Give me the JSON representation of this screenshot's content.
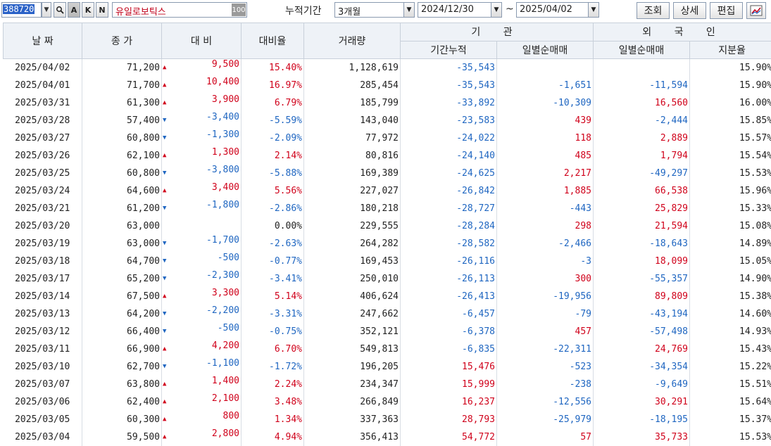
{
  "toolbar": {
    "stock_code": "388720",
    "stock_name": "유일로보틱스",
    "name_extra": "100",
    "period_label": "누적기간",
    "period_value": "3개월",
    "start_date": "2024/12/30",
    "tilde": "~",
    "end_date": "2025/04/02",
    "query_button": "조회",
    "detail_button": "상세",
    "edit_button": "편집",
    "small_btn_a": "A",
    "small_btn_k": "K",
    "small_btn_n": "N"
  },
  "headers": {
    "date": "날 짜",
    "close": "종 가",
    "change": "대 비",
    "change_rate": "대비율",
    "volume": "거래량",
    "institution": "기 관",
    "inst_cumulative": "기간누적",
    "inst_daily": "일별순매매",
    "foreign": "외 국 인",
    "foreign_daily": "일별순매매",
    "foreign_share": "지분율"
  },
  "rows": [
    {
      "date": "2025/04/02",
      "close": "71,200",
      "dir": "up",
      "change": "9,500",
      "rate": "15.40%",
      "volume": "1,128,619",
      "inst_cum": "-35,543",
      "inst_daily": "",
      "frgn_daily": "",
      "share": "15.90%"
    },
    {
      "date": "2025/04/01",
      "close": "71,700",
      "dir": "up",
      "change": "10,400",
      "rate": "16.97%",
      "volume": "285,454",
      "inst_cum": "-35,543",
      "inst_daily": "-1,651",
      "frgn_daily": "-11,594",
      "share": "15.90%"
    },
    {
      "date": "2025/03/31",
      "close": "61,300",
      "dir": "up",
      "change": "3,900",
      "rate": "6.79%",
      "volume": "185,799",
      "inst_cum": "-33,892",
      "inst_daily": "-10,309",
      "frgn_daily": "16,560",
      "share": "16.00%"
    },
    {
      "date": "2025/03/28",
      "close": "57,400",
      "dir": "down",
      "change": "-3,400",
      "rate": "-5.59%",
      "volume": "143,040",
      "inst_cum": "-23,583",
      "inst_daily": "439",
      "frgn_daily": "-2,444",
      "share": "15.85%"
    },
    {
      "date": "2025/03/27",
      "close": "60,800",
      "dir": "down",
      "change": "-1,300",
      "rate": "-2.09%",
      "volume": "77,972",
      "inst_cum": "-24,022",
      "inst_daily": "118",
      "frgn_daily": "2,889",
      "share": "15.57%"
    },
    {
      "date": "2025/03/26",
      "close": "62,100",
      "dir": "up",
      "change": "1,300",
      "rate": "2.14%",
      "volume": "80,816",
      "inst_cum": "-24,140",
      "inst_daily": "485",
      "frgn_daily": "1,794",
      "share": "15.54%"
    },
    {
      "date": "2025/03/25",
      "close": "60,800",
      "dir": "down",
      "change": "-3,800",
      "rate": "-5.88%",
      "volume": "169,389",
      "inst_cum": "-24,625",
      "inst_daily": "2,217",
      "frgn_daily": "-49,297",
      "share": "15.53%"
    },
    {
      "date": "2025/03/24",
      "close": "64,600",
      "dir": "up",
      "change": "3,400",
      "rate": "5.56%",
      "volume": "227,027",
      "inst_cum": "-26,842",
      "inst_daily": "1,885",
      "frgn_daily": "66,538",
      "share": "15.96%"
    },
    {
      "date": "2025/03/21",
      "close": "61,200",
      "dir": "down",
      "change": "-1,800",
      "rate": "-2.86%",
      "volume": "180,218",
      "inst_cum": "-28,727",
      "inst_daily": "-443",
      "frgn_daily": "25,829",
      "share": "15.33%"
    },
    {
      "date": "2025/03/20",
      "close": "63,000",
      "dir": "none",
      "change": "",
      "rate": "0.00%",
      "volume": "229,555",
      "inst_cum": "-28,284",
      "inst_daily": "298",
      "frgn_daily": "21,594",
      "share": "15.08%"
    },
    {
      "date": "2025/03/19",
      "close": "63,000",
      "dir": "down",
      "change": "-1,700",
      "rate": "-2.63%",
      "volume": "264,282",
      "inst_cum": "-28,582",
      "inst_daily": "-2,466",
      "frgn_daily": "-18,643",
      "share": "14.89%"
    },
    {
      "date": "2025/03/18",
      "close": "64,700",
      "dir": "down",
      "change": "-500",
      "rate": "-0.77%",
      "volume": "169,453",
      "inst_cum": "-26,116",
      "inst_daily": "-3",
      "frgn_daily": "18,099",
      "share": "15.05%"
    },
    {
      "date": "2025/03/17",
      "close": "65,200",
      "dir": "down",
      "change": "-2,300",
      "rate": "-3.41%",
      "volume": "250,010",
      "inst_cum": "-26,113",
      "inst_daily": "300",
      "frgn_daily": "-55,357",
      "share": "14.90%"
    },
    {
      "date": "2025/03/14",
      "close": "67,500",
      "dir": "up",
      "change": "3,300",
      "rate": "5.14%",
      "volume": "406,624",
      "inst_cum": "-26,413",
      "inst_daily": "-19,956",
      "frgn_daily": "89,809",
      "share": "15.38%"
    },
    {
      "date": "2025/03/13",
      "close": "64,200",
      "dir": "down",
      "change": "-2,200",
      "rate": "-3.31%",
      "volume": "247,662",
      "inst_cum": "-6,457",
      "inst_daily": "-79",
      "frgn_daily": "-43,194",
      "share": "14.60%"
    },
    {
      "date": "2025/03/12",
      "close": "66,400",
      "dir": "down",
      "change": "-500",
      "rate": "-0.75%",
      "volume": "352,121",
      "inst_cum": "-6,378",
      "inst_daily": "457",
      "frgn_daily": "-57,498",
      "share": "14.93%"
    },
    {
      "date": "2025/03/11",
      "close": "66,900",
      "dir": "up",
      "change": "4,200",
      "rate": "6.70%",
      "volume": "549,813",
      "inst_cum": "-6,835",
      "inst_daily": "-22,311",
      "frgn_daily": "24,769",
      "share": "15.43%"
    },
    {
      "date": "2025/03/10",
      "close": "62,700",
      "dir": "down",
      "change": "-1,100",
      "rate": "-1.72%",
      "volume": "196,205",
      "inst_cum": "15,476",
      "inst_daily": "-523",
      "frgn_daily": "-34,354",
      "share": "15.22%"
    },
    {
      "date": "2025/03/07",
      "close": "63,800",
      "dir": "up",
      "change": "1,400",
      "rate": "2.24%",
      "volume": "234,347",
      "inst_cum": "15,999",
      "inst_daily": "-238",
      "frgn_daily": "-9,649",
      "share": "15.51%"
    },
    {
      "date": "2025/03/06",
      "close": "62,400",
      "dir": "up",
      "change": "2,100",
      "rate": "3.48%",
      "volume": "266,849",
      "inst_cum": "16,237",
      "inst_daily": "-12,556",
      "frgn_daily": "30,291",
      "share": "15.64%"
    },
    {
      "date": "2025/03/05",
      "close": "60,300",
      "dir": "up",
      "change": "800",
      "rate": "1.34%",
      "volume": "337,363",
      "inst_cum": "28,793",
      "inst_daily": "-25,979",
      "frgn_daily": "-18,195",
      "share": "15.37%"
    },
    {
      "date": "2025/03/04",
      "close": "59,500",
      "dir": "up",
      "change": "2,800",
      "rate": "4.94%",
      "volume": "356,413",
      "inst_cum": "54,772",
      "inst_daily": "57",
      "frgn_daily": "35,733",
      "share": "15.53%"
    }
  ],
  "colors": {
    "up": "#d0021b",
    "down": "#1f66c1",
    "header_bg": "#eef2f7",
    "selection": "#2a62c8"
  },
  "icons": {
    "search": "search-icon",
    "chart": "chart-icon",
    "dropdown": "chevron-down-icon"
  }
}
